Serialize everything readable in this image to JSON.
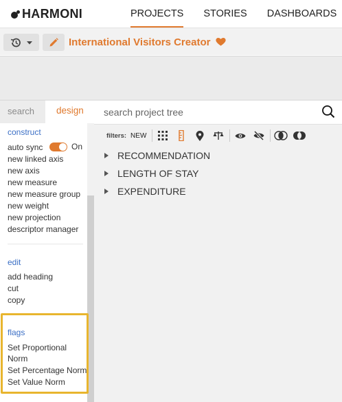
{
  "app": {
    "logo_text": "HARMONI",
    "nav": [
      {
        "label": "PROJECTS",
        "active": true
      },
      {
        "label": "STORIES",
        "active": false
      },
      {
        "label": "DASHBOARDS",
        "active": false
      }
    ]
  },
  "toolbar": {
    "project_title": "International Visitors Creator",
    "history_icon": "history-icon",
    "edit_icon": "pencil-icon",
    "favorite_icon": "heart-icon"
  },
  "sidebar": {
    "tabs": {
      "search": "search",
      "design": "design"
    },
    "construct": {
      "heading": "construct",
      "auto_sync_label": "auto sync",
      "auto_sync_state": "On",
      "items": [
        "new linked axis",
        "new axis",
        "new measure",
        "new measure group",
        "new weight",
        "new projection",
        "descriptor manager"
      ]
    },
    "edit": {
      "heading": "edit",
      "items": [
        "add heading",
        "cut",
        "copy"
      ]
    },
    "flags": {
      "heading": "flags",
      "items": [
        "Set Proportional",
        "Norm",
        "Set Percentage Norm",
        "Set Value Norm"
      ]
    }
  },
  "main": {
    "search": {
      "placeholder": "search project tree",
      "value": ""
    },
    "filters": {
      "label": "filters:",
      "new_label": "NEW"
    },
    "tree": [
      "RECOMMENDATION",
      "LENGTH OF STAY",
      "EXPENDITURE"
    ]
  },
  "colors": {
    "accent": "#e07a2f",
    "link": "#3b6fc5",
    "highlight": "#e8b52e"
  }
}
